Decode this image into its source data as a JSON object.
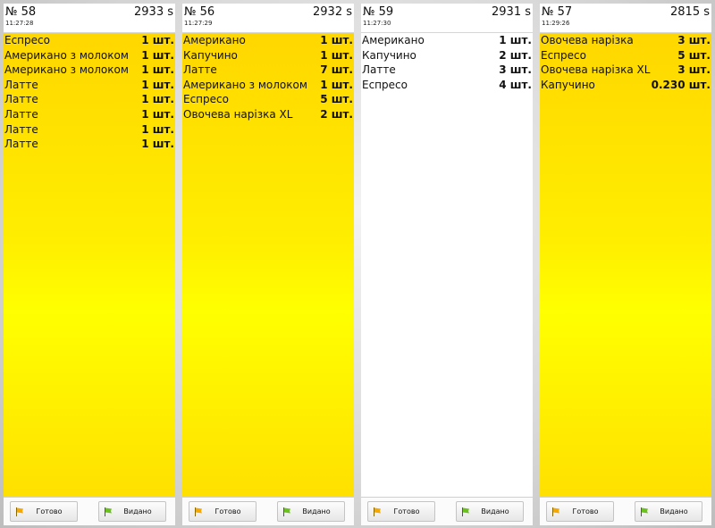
{
  "orders": [
    {
      "number": "№ 58",
      "elapsed": "2933 s",
      "time": "11:27:28",
      "theme": "yellow",
      "items": [
        {
          "name": "Еспресо",
          "qty": "1 шт."
        },
        {
          "name": "Американо з молоком",
          "qty": "1 шт."
        },
        {
          "name": "Американо з молоком",
          "qty": "1 шт."
        },
        {
          "name": "Латте",
          "qty": "1 шт."
        },
        {
          "name": "Латте",
          "qty": "1 шт."
        },
        {
          "name": "Латте",
          "qty": "1 шт."
        },
        {
          "name": "Латте",
          "qty": "1 шт."
        },
        {
          "name": "Латте",
          "qty": "1 шт."
        }
      ]
    },
    {
      "number": "№ 56",
      "elapsed": "2932 s",
      "time": "11:27:29",
      "theme": "yellow",
      "items": [
        {
          "name": "Американо",
          "qty": "1 шт."
        },
        {
          "name": "Капучино",
          "qty": "1 шт."
        },
        {
          "name": "Латте",
          "qty": "7 шт."
        },
        {
          "name": "Американо з молоком",
          "qty": "1 шт."
        },
        {
          "name": "Еспресо",
          "qty": "5 шт."
        },
        {
          "name": "Овочева нарізка XL",
          "qty": "2 шт."
        }
      ]
    },
    {
      "number": "№ 59",
      "elapsed": "2931 s",
      "time": "11:27:30",
      "theme": "white",
      "items": [
        {
          "name": "Американо",
          "qty": "1 шт."
        },
        {
          "name": "Капучино",
          "qty": "2 шт."
        },
        {
          "name": "Латте",
          "qty": "3 шт."
        },
        {
          "name": "Еспресо",
          "qty": "4 шт."
        }
      ]
    },
    {
      "number": "№ 57",
      "elapsed": "2815 s",
      "time": "11:29:26",
      "theme": "yellow",
      "items": [
        {
          "name": "Овочева нарізка",
          "qty": "3 шт."
        },
        {
          "name": "Еспресо",
          "qty": "5 шт."
        },
        {
          "name": "Овочева нарізка XL",
          "qty": "3 шт."
        },
        {
          "name": "Капучино",
          "qty": "0.230 шт."
        }
      ]
    }
  ],
  "buttons": {
    "done_label": "Готово",
    "given_label": "Видано",
    "done_icon": "orange-flag-icon",
    "given_icon": "green-flag-icon"
  },
  "colors": {
    "yellow_top": "#ffd700",
    "yellow_mid": "#ffff00",
    "flag_orange": "#f5a800",
    "flag_green": "#6cc21d"
  }
}
